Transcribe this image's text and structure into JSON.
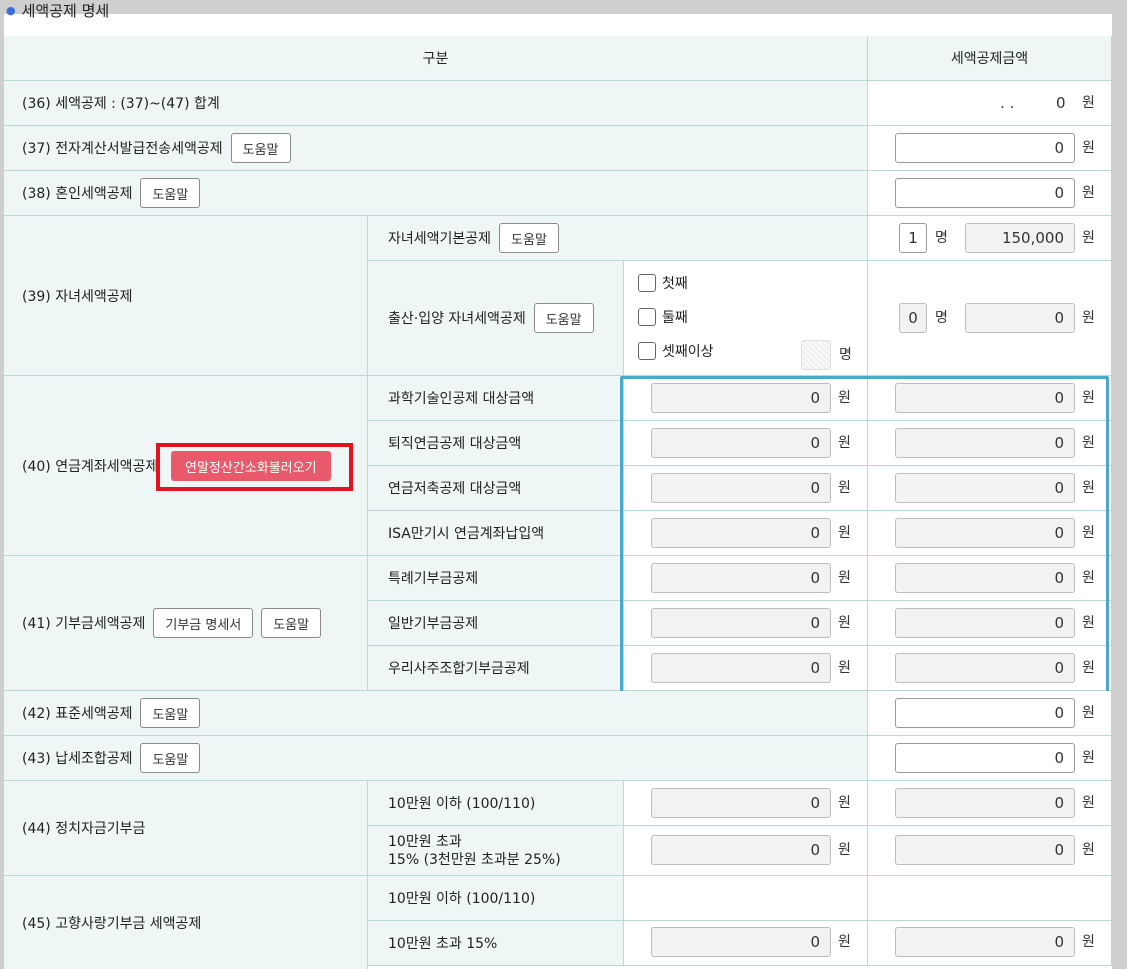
{
  "section": {
    "title": "세액공제 명세"
  },
  "header": {
    "category": "구분",
    "amount": "세액공제금액"
  },
  "units": {
    "won": "원",
    "person": "명"
  },
  "help_label": "도움말",
  "r36": {
    "label": "(36) 세액공제 : (37)~(47) 합계",
    "value": "0",
    "dots": ".   ."
  },
  "r37": {
    "label": "(37) 전자계산서발급전송세액공제",
    "value": "0"
  },
  "r38": {
    "label": "(38) 혼인세액공제",
    "value": "0"
  },
  "r39": {
    "label": "(39) 자녀세액공제",
    "basic": {
      "label": "자녀세액기본공제",
      "count": "1",
      "amount": "150,000"
    },
    "birth": {
      "label": "출산·입양 자녀세액공제",
      "options": [
        "첫째",
        "둘째",
        "셋째이상"
      ],
      "count": "0",
      "amount": "0"
    }
  },
  "r40": {
    "label": "(40) 연금계좌세액공제",
    "load_button": "연말정산간소화불러오기",
    "items": [
      {
        "label": "과학기술인공제 대상금액",
        "target": "0",
        "amount": "0"
      },
      {
        "label": "퇴직연금공제 대상금액",
        "target": "0",
        "amount": "0"
      },
      {
        "label": "연금저축공제 대상금액",
        "target": "0",
        "amount": "0"
      },
      {
        "label": "ISA만기시 연금계좌납입액",
        "target": "0",
        "amount": "0"
      }
    ]
  },
  "r41": {
    "label": "(41) 기부금세액공제",
    "detail_button": "기부금 명세서",
    "items": [
      {
        "label": "특례기부금공제",
        "target": "0",
        "amount": "0"
      },
      {
        "label": "일반기부금공제",
        "target": "0",
        "amount": "0"
      },
      {
        "label": "우리사주조합기부금공제",
        "target": "0",
        "amount": "0"
      }
    ]
  },
  "r42": {
    "label": "(42) 표준세액공제",
    "value": "0"
  },
  "r43": {
    "label": "(43) 납세조합공제",
    "value": "0"
  },
  "r44": {
    "label": "(44) 정치자금기부금",
    "items": [
      {
        "label": "10만원 이하 (100/110)",
        "target": "0",
        "amount": "0"
      },
      {
        "label_line1": "10만원 초과",
        "label_line2": "15% (3천만원 초과분 25%)",
        "target": "0",
        "amount": "0"
      }
    ]
  },
  "r45": {
    "label": "(45) 고향사랑기부금 세액공제",
    "items": [
      {
        "label": "10만원 이하 (100/110)",
        "target": "",
        "amount": ""
      },
      {
        "label": "10만원 초과 15%",
        "target": "0",
        "amount": "0"
      }
    ]
  },
  "colors": {
    "cell_bg": "#eef7f6",
    "border": "#b9d9d6",
    "highlight_red": "#e2121f",
    "highlight_blue": "#4aa9c9",
    "load_button": "#e85a6b"
  }
}
